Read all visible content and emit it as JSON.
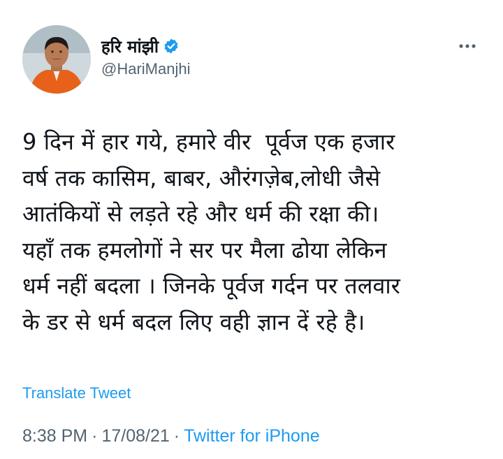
{
  "tweet": {
    "author": {
      "display_name": "हरि मांझी",
      "handle": "@HariManjhi",
      "verified": true
    },
    "text": "9 दिन में हार गये, हमारे वीर  पूर्वज एक हजार\nवर्ष तक कासिम, बाबर, औरंगज़ेब,लोधी जैसे\nआतंकियों से लड़ते रहे और धर्म की रक्षा की।\nयहाँ तक हमलोगों ने सर पर मैला ढोया लेकिन\nधर्म नहीं बदला । जिनके पूर्वज गर्दन पर तलवार\nके डर से धर्म बदल लिए वही ज्ञान दें रहे है।",
    "translate_label": "Translate Tweet",
    "time": "8:38 PM",
    "date": "17/08/21",
    "source": "Twitter for iPhone",
    "separator": "·"
  },
  "icons": {
    "verified": "verified-badge-icon",
    "more": "more-options-icon"
  },
  "colors": {
    "text": "#0f1419",
    "secondary": "#536471",
    "accent": "#1d9bf0"
  }
}
